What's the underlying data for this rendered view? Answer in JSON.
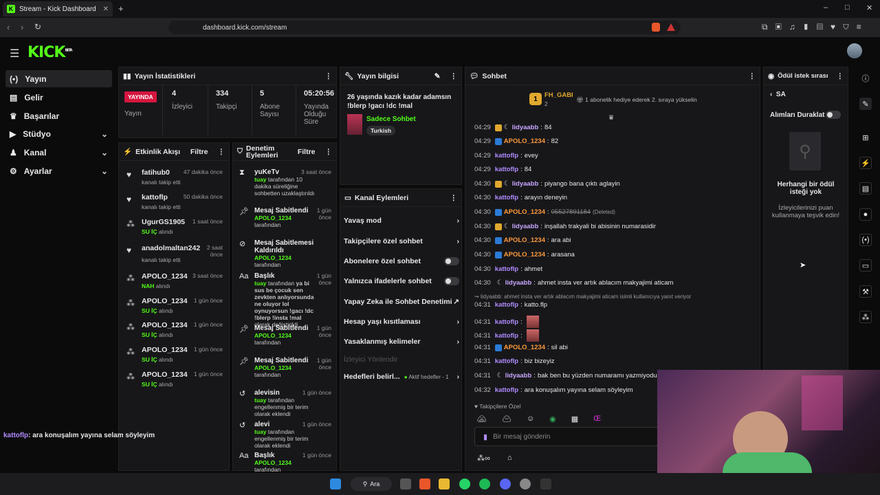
{
  "browser": {
    "tab_title": "Stream - Kick Dashboard",
    "url": "dashboard.kick.com/stream"
  },
  "brand": {
    "logo": "KICK",
    "beta": "BETA",
    "accent": "#53fc18"
  },
  "sidebar": {
    "items": [
      {
        "label": "Yayın",
        "icon": "broadcast-icon"
      },
      {
        "label": "Gelir",
        "icon": "wallet-icon"
      },
      {
        "label": "Başarılar",
        "icon": "trophy-icon"
      },
      {
        "label": "Stüdyo",
        "icon": "video-icon"
      },
      {
        "label": "Kanal",
        "icon": "person-icon"
      },
      {
        "label": "Ayarlar",
        "icon": "gear-icon"
      }
    ]
  },
  "stats": {
    "title": "Yayın İstatistikleri",
    "live_badge": "YAYINDA",
    "live_label": "Yayın",
    "viewers_value": "4",
    "viewers_label": "İzleyici",
    "followers_value": "334",
    "followers_label": "Takipçi",
    "subs_value": "5",
    "subs_label": "Abone Sayısı",
    "uptime_value": "05:20:56",
    "uptime_label": "Yayında Olduğu Süre"
  },
  "stream_info": {
    "title": "Yayın bilgisi",
    "stream_title": "26 yaşında kazık kadar adamsın !blerp !gacı !dc !mal",
    "category": "Sadece Sohbet",
    "language": "Turkish"
  },
  "activity": {
    "title": "Etkinlik Akışı",
    "filter": "Filtre",
    "events": [
      {
        "user": "fatihub0",
        "desc": "kanalı takip etti",
        "time": "47 dakika önce",
        "icon": "heart-icon"
      },
      {
        "user": "kattoflp",
        "desc": "kanalı takip etti",
        "time": "50 dakika önce",
        "icon": "heart-icon"
      },
      {
        "user": "UgurGS1905",
        "item": "SU İÇ",
        "desc": "alındı",
        "time": "1 saat önce",
        "icon": "dots-icon"
      },
      {
        "user": "anadolmaltan242",
        "desc": "kanalı takip etti",
        "time": "2 saat önce",
        "icon": "heart-icon"
      },
      {
        "user": "APOLO_1234",
        "item": "NAH",
        "desc": "alındı",
        "time": "3 saat önce",
        "icon": "dots-icon"
      },
      {
        "user": "APOLO_1234",
        "item": "SU İÇ",
        "desc": "alındı",
        "time": "1 gün önce",
        "icon": "dots-icon"
      },
      {
        "user": "APOLO_1234",
        "item": "SU İÇ",
        "desc": "alındı",
        "time": "1 gün önce",
        "icon": "dots-icon"
      },
      {
        "user": "APOLO_1234",
        "item": "SU İÇ",
        "desc": "alındı",
        "time": "1 gün önce",
        "icon": "dots-icon"
      },
      {
        "user": "APOLO_1234",
        "item": "SU İÇ",
        "desc": "alındı",
        "time": "1 gün önce",
        "icon": "dots-icon"
      }
    ]
  },
  "mod_actions": {
    "title": "Denetim Eylemleri",
    "filter": "Filtre",
    "items": [
      {
        "title": "yuKeTv",
        "time": "3 saat önce",
        "actor": "tuay",
        "rest": "tarafından 10 dakika süreliğine sohbetten uzaklaştırıldı",
        "icon": "hourglass-icon"
      },
      {
        "title": "Mesaj Sabitlendi",
        "time": "1 gün önce",
        "actor": "APOLO_1234",
        "rest": "tarafından",
        "icon": "pin-icon"
      },
      {
        "title": "Mesaj Sabitlemesi Kaldırıldı",
        "time": "1 gün önce",
        "actor": "APOLO_1234",
        "rest": "tarafından",
        "icon": "unpin-icon"
      },
      {
        "title": "Başlık",
        "time": "1 gün önce",
        "actor": "tuay",
        "rest": "tarafından",
        "extra": "ya bi sus be çocuk sen zevkten anlıyorsunda ne oluyor lol oynuyorsun !gacı !dc !blerp !insta !mal",
        "tail": "olarak değiştirildi",
        "icon": "title-icon"
      },
      {
        "title": "Mesaj Sabitlendi",
        "time": "1 gün önce",
        "actor": "APOLO_1234",
        "rest": "tarafından",
        "icon": "pin-icon"
      },
      {
        "title": "Mesaj Sabitlendi",
        "time": "1 gün önce",
        "actor": "APOLO_1234",
        "rest": "tarafından",
        "icon": "pin-icon"
      },
      {
        "title": "alevisin",
        "time": "1 gün önce",
        "actor": "tuay",
        "rest": "tarafından engellenmiş bir terim olarak eklendi",
        "icon": "undo-icon"
      },
      {
        "title": "alevi",
        "time": "1 gün önce",
        "actor": "tuay",
        "rest": "tarafından engellenmiş bir terim olarak eklendi",
        "icon": "undo-icon"
      },
      {
        "title": "Başlık",
        "time": "1 gün önce",
        "actor": "APOLO_1234",
        "rest": "tarafından",
        "icon": "title-icon"
      }
    ]
  },
  "channel_actions": {
    "title": "Kanal Eylemleri",
    "items": [
      {
        "label": "Yavaş mod",
        "kind": "arrow"
      },
      {
        "label": "Takipçilere özel sohbet",
        "kind": "arrow"
      },
      {
        "label": "Abonelere özel sohbet",
        "kind": "toggle"
      },
      {
        "label": "Yalnızca ifadelerle sohbet",
        "kind": "toggle"
      },
      {
        "label": "Yapay Zeka ile Sohbet Denetimi",
        "kind": "external"
      },
      {
        "label": "Hesap yaşı kısıtlaması",
        "kind": "arrow"
      },
      {
        "label": "Yasaklanmış kelimeler",
        "kind": "arrow"
      },
      {
        "label": "İzleyici Yönlendir",
        "kind": "disabled"
      },
      {
        "label": "Hedefleri belirl...",
        "kind": "goals",
        "status": "Aktif hedefler - 1"
      }
    ]
  },
  "chat": {
    "title": "Sohbet",
    "pinned_rank": "1",
    "pinned_user": "FH_GABI",
    "pinned_count": "2",
    "pinned_text": "1 abonelik hediye ederek 2. sıraya yükselin",
    "reply_note": "lidyaabb: ahmet insta ver artık ablacım makyajimi aticam isimli kullanıcıya yanıt veriyor",
    "deleted_tag": "(Deleted)",
    "followers_only": "Takipçilere Özel",
    "input_placeholder": "Bir mesaj gönderin",
    "messages": [
      {
        "time": "04:29",
        "user": "lidyaabb",
        "text": "84",
        "color": "#c9a7ff",
        "badge": "crown"
      },
      {
        "time": "04:29",
        "user": "APOLO_1234",
        "text": "82",
        "color": "#ff9a3c",
        "badge": "kick"
      },
      {
        "time": "04:29",
        "user": "kattoflp",
        "text": "evey",
        "color": "#b18cff",
        "badge": ""
      },
      {
        "time": "04:29",
        "user": "kattoflp",
        "text": "84",
        "color": "#b18cff",
        "badge": ""
      },
      {
        "time": "04:30",
        "user": "lidyaabb",
        "text": "piyango bana çıktı aglayin",
        "color": "#c9a7ff",
        "badge": "crown"
      },
      {
        "time": "04:30",
        "user": "kattoflp",
        "text": "arayın deneyin",
        "color": "#b18cff",
        "badge": ""
      },
      {
        "time": "04:30",
        "user": "APOLO_1234",
        "text": "05527891184",
        "color": "#ff9a3c",
        "badge": "kick",
        "deleted": true
      },
      {
        "time": "04:30",
        "user": "lidyaabb",
        "text": "inşallah trakyali bi abisinin numarasidir",
        "color": "#c9a7ff",
        "badge": "crown"
      },
      {
        "time": "04:30",
        "user": "APOLO_1234",
        "text": "ara abi",
        "color": "#ff9a3c",
        "badge": "kick"
      },
      {
        "time": "04:30",
        "user": "APOLO_1234",
        "text": "arasana",
        "color": "#ff9a3c",
        "badge": "kick"
      },
      {
        "time": "04:30",
        "user": "kattoflp",
        "text": "ahmet",
        "color": "#b18cff",
        "badge": ""
      },
      {
        "time": "04:30",
        "user": "lidyaabb",
        "text": "ahmet insta ver artık ablacım makyajimi aticam",
        "color": "#c9a7ff",
        "badge": "crown"
      },
      {
        "time": "04:31",
        "user": "kattoflp",
        "text": "katto.flp",
        "color": "#b18cff",
        "badge": "",
        "reply": true
      },
      {
        "time": "04:31",
        "user": "kattoflp",
        "text": "",
        "color": "#b18cff",
        "badge": "",
        "emote": true
      },
      {
        "time": "04:31",
        "user": "kattoflp",
        "text": "",
        "color": "#b18cff",
        "badge": "",
        "emote": true
      },
      {
        "time": "04:31",
        "user": "APOLO_1234",
        "text": "sil abi",
        "color": "#ff9a3c",
        "badge": "kick"
      },
      {
        "time": "04:31",
        "user": "kattoflp",
        "text": "biz bizeyiz",
        "color": "#b18cff",
        "badge": ""
      },
      {
        "time": "04:31",
        "user": "lidyaabb",
        "text": "bak ben bu yüzden numaramı yazmiyodum",
        "color": "#c9a7ff",
        "badge": "crown"
      },
      {
        "time": "04:32",
        "user": "kattoflp",
        "text": "ara konuşalım yayına selam söyleyim",
        "color": "#b18cff",
        "badge": ""
      }
    ]
  },
  "rewards": {
    "title": "Ödül istek sırası",
    "back_label": "SA",
    "pause_label": "Alımları Duraklat",
    "empty_title": "Herhangi bir ödül isteği yok",
    "empty_desc": "İzleyicilerinizi puan kullanmaya teşvik edin!"
  },
  "overlay": {
    "user": "kattoflp",
    "text": ": ara konuşalım yayına selam söyleyim"
  },
  "taskbar": {
    "search": "Ara"
  }
}
